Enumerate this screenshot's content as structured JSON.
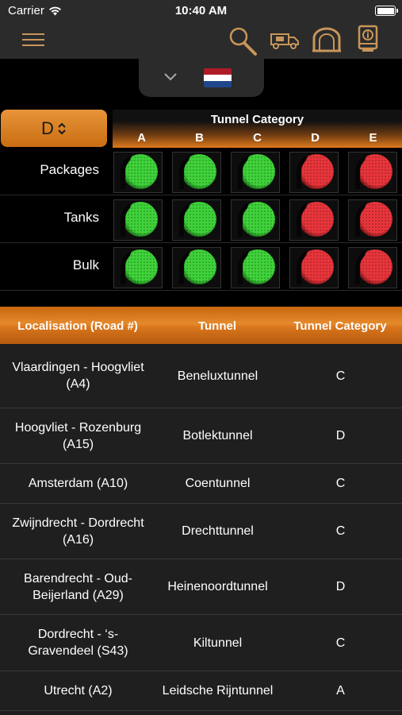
{
  "status_bar": {
    "carrier": "Carrier",
    "time": "10:40 AM"
  },
  "nav": {
    "icons": [
      "menu-icon",
      "search-icon",
      "truck-icon",
      "tunnel-icon",
      "info-book-icon"
    ]
  },
  "country": {
    "flag": "netherlands",
    "colors": [
      "#ae1c28",
      "#ffffff",
      "#21468b"
    ]
  },
  "selector": {
    "value": "D",
    "arrows": "⌃⌄"
  },
  "category_header": {
    "title": "Tunnel Category",
    "letters": [
      "A",
      "B",
      "C",
      "D",
      "E"
    ]
  },
  "light_rows": [
    {
      "label": "Packages",
      "states": [
        "green",
        "green",
        "green",
        "red",
        "red"
      ]
    },
    {
      "label": "Tanks",
      "states": [
        "green",
        "green",
        "green",
        "red",
        "red"
      ]
    },
    {
      "label": "Bulk",
      "states": [
        "green",
        "green",
        "green",
        "red",
        "red"
      ]
    }
  ],
  "table": {
    "headers": {
      "localisation": "Localisation (Road #)",
      "tunnel": "Tunnel",
      "category": "Tunnel Category"
    },
    "rows": [
      {
        "loc1": "Vlaardingen - Hoogvliet",
        "loc2": "(A4)",
        "tunnel": "Beneluxtunnel",
        "category": "C"
      },
      {
        "loc1": "Hoogvliet - Rozenburg",
        "loc2": "(A15)",
        "tunnel": "Botlektunnel",
        "category": "D"
      },
      {
        "loc1": "Amsterdam (A10)",
        "loc2": "",
        "tunnel": "Coentunnel",
        "category": "C"
      },
      {
        "loc1": "Zwijndrecht - Dordrecht",
        "loc2": "(A16)",
        "tunnel": "Drechttunnel",
        "category": "C"
      },
      {
        "loc1": "Barendrecht - Oud-",
        "loc2": "Beijerland (A29)",
        "tunnel": "Heinenoordtunnel",
        "category": "D"
      },
      {
        "loc1": "Dordrecht - ‘s-",
        "loc2": "Gravendeel (S43)",
        "tunnel": "Kiltunnel",
        "category": "C"
      },
      {
        "loc1": "Utrecht (A2)",
        "loc2": "",
        "tunnel": "Leidsche Rijntunnel",
        "category": "A"
      }
    ]
  },
  "colors": {
    "accent": "#e07a1c",
    "icon": "#c8965a",
    "green": "#3fd23a",
    "red": "#e8353b"
  }
}
